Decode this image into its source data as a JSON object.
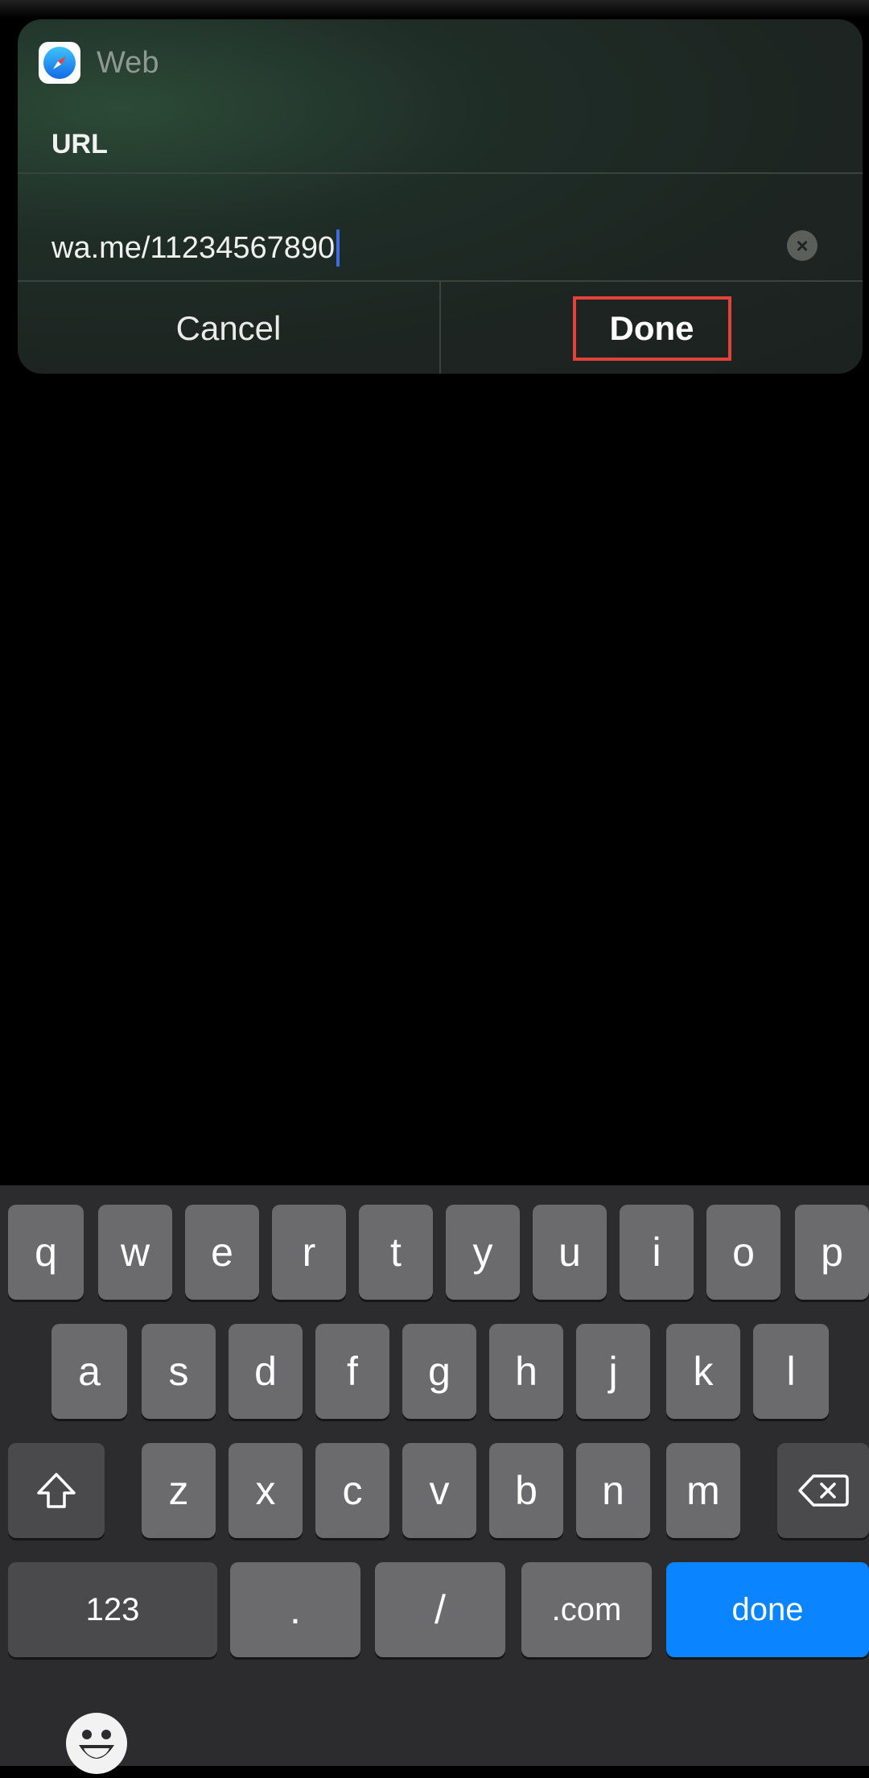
{
  "dialog": {
    "app_name": "Web",
    "app_icon": "safari-compass-icon",
    "field_label": "URL",
    "url_value": "wa.me/11234567890",
    "clear_icon": "clear-circle-icon",
    "cancel_label": "Cancel",
    "done_label": "Done",
    "highlight_color": "#e2423a"
  },
  "keyboard": {
    "row1": [
      "q",
      "w",
      "e",
      "r",
      "t",
      "y",
      "u",
      "i",
      "o",
      "p"
    ],
    "row2": [
      "a",
      "s",
      "d",
      "f",
      "g",
      "h",
      "j",
      "k",
      "l"
    ],
    "row3": [
      "z",
      "x",
      "c",
      "v",
      "b",
      "n",
      "m"
    ],
    "shift_icon": "shift-arrow-icon",
    "delete_icon": "backspace-icon",
    "numbers_label": "123",
    "dot_label": ".",
    "slash_label": "/",
    "dotcom_label": ".com",
    "done_label": "done",
    "emoji_icon": "emoji-smiley-icon",
    "accent_color": "#0a84ff"
  }
}
